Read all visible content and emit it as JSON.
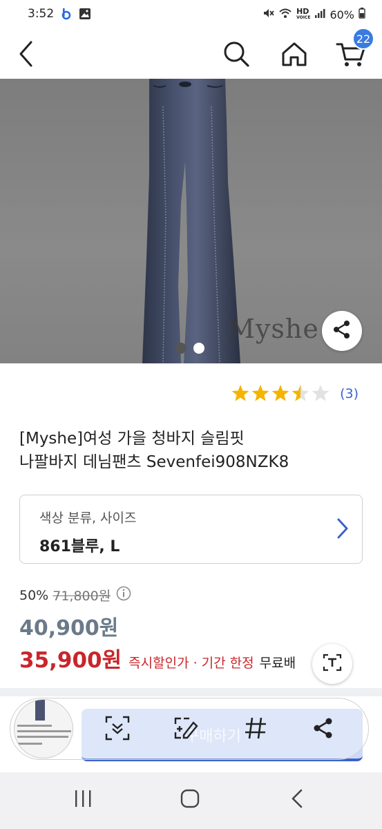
{
  "status_bar": {
    "time": "3:52",
    "left_icons": [
      "b-app-icon",
      "gallery-icon"
    ],
    "right_icons": [
      "mute-icon",
      "wifi-icon"
    ],
    "network_label": "HD",
    "network_sub": "VOICE",
    "battery": "60%"
  },
  "appbar": {
    "back_icon": "back-arrow-icon",
    "search_icon": "search-icon",
    "home_icon": "home-icon",
    "cart_icon": "cart-icon",
    "cart_count": "22"
  },
  "hero": {
    "brand_mark": "Myshe",
    "share_icon": "share-icon",
    "pages": 2,
    "active_page": 1
  },
  "product": {
    "rating": 3.5,
    "rating_max": 5,
    "review_count": "(3)",
    "title_line1": "[Myshe]여성 가을 청바지 슬림핏",
    "title_line2": "나팔바지 데님팬츠 Sevenfei908NZK8"
  },
  "option": {
    "label": "색상 분류, 사이즈",
    "value": "861블루, L",
    "chevron_icon": "chevron-right-icon"
  },
  "price": {
    "discount_percent": "50%",
    "original_price": "71,800원",
    "info_icon": "info-icon",
    "sale_price": "40,900원",
    "promo_price": "35,900원",
    "promo_desc": "즉시할인가 · 기간 한정",
    "shipping": "무료배"
  },
  "buy_bar": {
    "label": "구매하기"
  },
  "capture_toolbar": {
    "tools": [
      "scroll-capture-icon",
      "edit-capture-icon",
      "tag-icon",
      "share-icon"
    ],
    "text_extract_icon": "text-extract-icon"
  },
  "colors": {
    "accent": "#3a62c9",
    "promo_red": "#c8262b",
    "star": "#f5b400"
  },
  "navbar": {
    "buttons": [
      "recents-icon",
      "home-icon",
      "back-icon"
    ]
  }
}
